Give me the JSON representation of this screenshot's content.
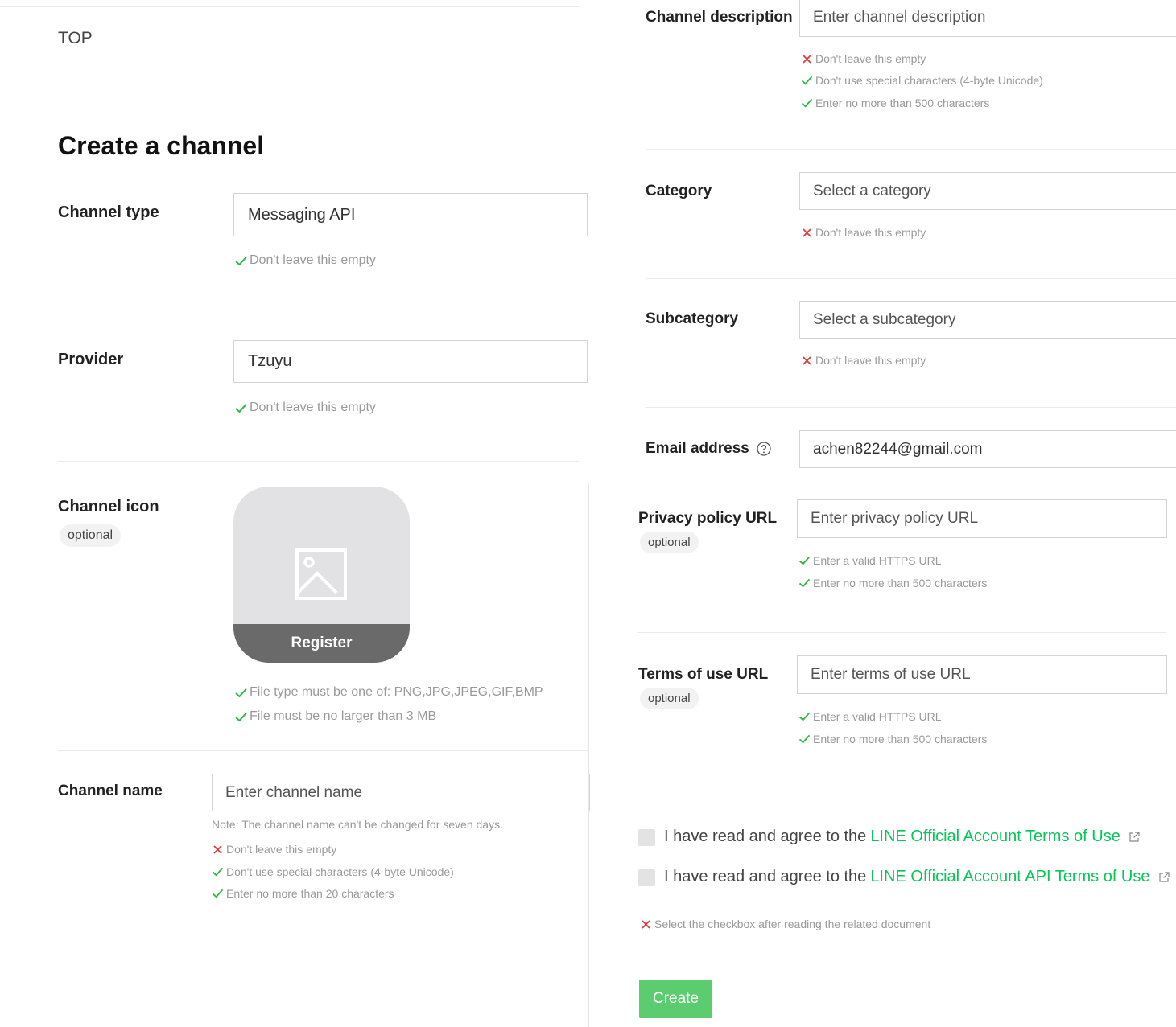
{
  "breadcrumb": "TOP",
  "page_title": "Create a channel",
  "channel_type": {
    "label": "Channel type",
    "value": "Messaging API",
    "rules": [
      "Don't leave this empty"
    ]
  },
  "provider": {
    "label": "Provider",
    "value": "Tzuyu",
    "rules": [
      "Don't leave this empty"
    ]
  },
  "channel_icon": {
    "label": "Channel icon",
    "badge": "optional",
    "register": "Register",
    "rules": [
      "File type must be one of: PNG,JPG,JPEG,GIF,BMP",
      "File must be no larger than 3 MB"
    ]
  },
  "channel_name": {
    "label": "Channel name",
    "placeholder": "Enter channel name",
    "note": "Note: The channel name can't be changed for seven days.",
    "rules": [
      "Don't leave this empty",
      "Don't use special characters (4-byte Unicode)",
      "Enter no more than 20 characters"
    ],
    "rule_status": [
      "error",
      "ok",
      "ok"
    ]
  },
  "channel_description": {
    "label": "Channel description",
    "placeholder": "Enter channel description",
    "rules": [
      "Don't leave this empty",
      "Don't use special characters (4-byte Unicode)",
      "Enter no more than 500 characters"
    ],
    "rule_status": [
      "error",
      "ok",
      "ok"
    ]
  },
  "category": {
    "label": "Category",
    "placeholder": "Select a category",
    "rules": [
      "Don't leave this empty"
    ]
  },
  "subcategory": {
    "label": "Subcategory",
    "placeholder": "Select a subcategory",
    "rules": [
      "Don't leave this empty"
    ]
  },
  "email": {
    "label": "Email address",
    "value": "achen82244@gmail.com"
  },
  "privacy_policy": {
    "label": "Privacy policy URL",
    "badge": "optional",
    "placeholder": "Enter privacy policy URL",
    "rules": [
      "Enter a valid HTTPS URL",
      "Enter no more than 500 characters"
    ]
  },
  "terms_of_use": {
    "label": "Terms of use URL",
    "badge": "optional",
    "placeholder": "Enter terms of use URL",
    "rules": [
      "Enter a valid HTTPS URL",
      "Enter no more than 500 characters"
    ]
  },
  "agreements": [
    {
      "prefix": "I have read and agree to the",
      "link": "LINE Official Account Terms of Use",
      "checked": false
    },
    {
      "prefix": "I have read and agree to the",
      "link": "LINE Official Account API Terms of Use",
      "checked": false
    }
  ],
  "agreement_error": "Select the checkbox after reading the related document",
  "create_button": "Create",
  "colors": {
    "accent": "#06c755",
    "button": "#5ccd6e",
    "ok": "#2fb944",
    "error": "#e03b3b"
  }
}
